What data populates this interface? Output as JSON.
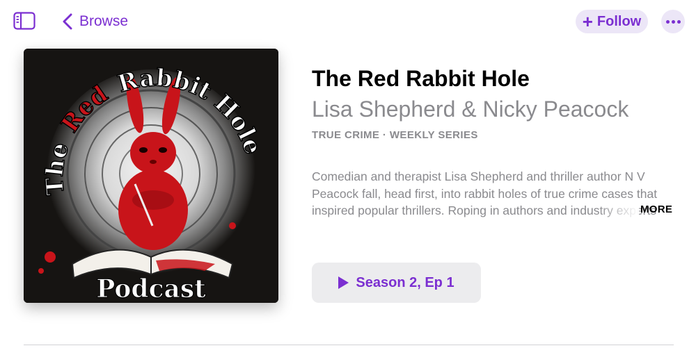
{
  "nav": {
    "back_label": "Browse",
    "follow_label": "Follow"
  },
  "podcast": {
    "title": "The Red Rabbit Hole",
    "author": "Lisa Shepherd & Nicky Peacock",
    "meta": "TRUE CRIME · WEEKLY SERIES",
    "description": "Comedian and therapist Lisa Shepherd and thriller author N V Peacock fall, head first, into rabbit holes of true crime cases that inspired popular thrillers. Roping in authors and industry experts",
    "more_label": "MORE",
    "play_label": "Season 2, Ep 1"
  },
  "artwork": {
    "arc_title_red": "Red",
    "arc_title_the": "The",
    "arc_title_rest": "Rabbit Hole",
    "bottom_label": "Podcast"
  },
  "colors": {
    "accent": "#7b2fd1",
    "secondary_text": "#8a8a8e",
    "art_red": "#c8141a"
  }
}
